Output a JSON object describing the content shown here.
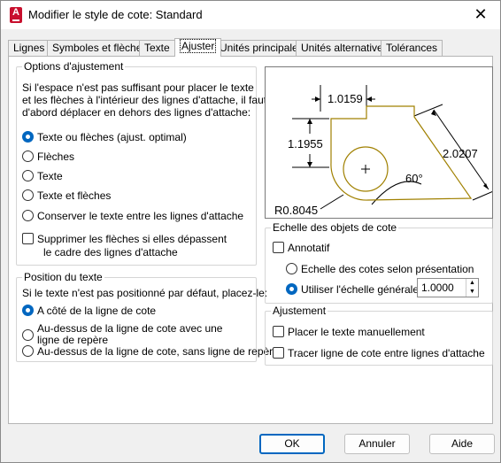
{
  "window": {
    "title": "Modifier le style de cote: Standard",
    "app_icon": "A"
  },
  "tabs": [
    {
      "label": "Lignes"
    },
    {
      "label": "Symboles et flèches"
    },
    {
      "label": "Texte"
    },
    {
      "label": "Ajuster"
    },
    {
      "label": "Unités principales"
    },
    {
      "label": "Unités alternatives"
    },
    {
      "label": "Tolérances"
    }
  ],
  "fit_options": {
    "title": "Options d'ajustement",
    "description_lines": [
      "Si l'espace n'est pas suffisant pour placer le texte",
      "et les flèches à l'intérieur des lignes d'attache, il faut",
      "d'abord déplacer en dehors des lignes d'attache:"
    ],
    "radios": [
      {
        "label": "Texte ou flèches (ajust. optimal)",
        "selected": true
      },
      {
        "label": "Flèches",
        "selected": false
      },
      {
        "label": "Texte",
        "selected": false
      },
      {
        "label": "Texte et flèches",
        "selected": false
      },
      {
        "label": "Conserver le texte entre les lignes d'attache",
        "selected": false
      }
    ],
    "suppress": {
      "label_line1": "Supprimer les flèches si elles dépassent",
      "label_line2": "le cadre des lignes d'attache",
      "checked": false
    }
  },
  "text_position": {
    "title": "Position du texte",
    "description": "Si le texte n'est pas positionné par défaut, placez-le:",
    "radios": [
      {
        "label": "A côté de la ligne de cote",
        "selected": true
      },
      {
        "label": "Au-dessus de la ligne de cote avec une",
        "label2": "ligne de repère",
        "selected": false
      },
      {
        "label": "Au-dessus de la ligne de cote, sans ligne de repère",
        "selected": false
      }
    ]
  },
  "preview": {
    "dim_top": "1.0159",
    "dim_left": "1.1955",
    "dim_right": "2.0207",
    "angle": "60°",
    "radius": "R0.8045"
  },
  "scale": {
    "title": "Echelle des objets de cote",
    "annotative": {
      "label": "Annotatif",
      "checked": false
    },
    "radios": [
      {
        "label": "Echelle des cotes selon présentation",
        "selected": false
      },
      {
        "label": "Utiliser l'échelle générale de:",
        "selected": true
      }
    ],
    "overall_scale_value": "1.0000"
  },
  "fine_tuning": {
    "title": "Ajustement",
    "checks": [
      {
        "label": "Placer le texte manuellement",
        "checked": false
      },
      {
        "label": "Tracer ligne de cote entre lignes d'attache",
        "checked": false
      }
    ]
  },
  "buttons": {
    "ok": "OK",
    "cancel": "Annuler",
    "help": "Aide"
  },
  "colors": {
    "accent": "#0067c0",
    "preview_outline": "#a08000",
    "app_icon": "#c8102e"
  }
}
